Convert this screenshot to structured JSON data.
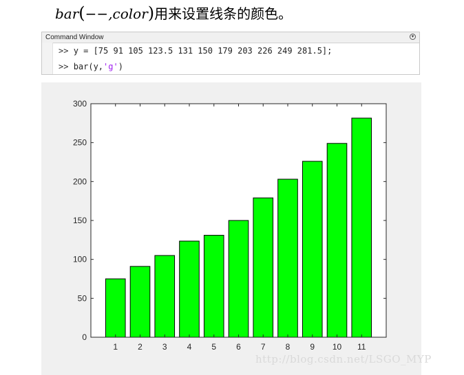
{
  "heading": {
    "formula": "bar",
    "paren_open": "(",
    "args": "−−,color",
    "paren_close": ")",
    "text": "用来设置线条的颜色。"
  },
  "command_window": {
    "title": "Command Window",
    "lines": [
      {
        "prompt": ">>",
        "code": "y = [75 91 105 123.5 131 150 179 203 226 249 281.5];"
      },
      {
        "prompt": ">>",
        "code_before": "bar(y,",
        "string": "'g'",
        "code_after": ")"
      }
    ]
  },
  "chart_data": {
    "type": "bar",
    "categories": [
      "1",
      "2",
      "3",
      "4",
      "5",
      "6",
      "7",
      "8",
      "9",
      "10",
      "11"
    ],
    "values": [
      75,
      91,
      105,
      123.5,
      131,
      150,
      179,
      203,
      226,
      249,
      281.5
    ],
    "bar_color": "#00ff00",
    "edge_color": "#000000",
    "ylim": [
      0,
      300
    ],
    "yticks": [
      0,
      50,
      100,
      150,
      200,
      250,
      300
    ],
    "title": "",
    "xlabel": "",
    "ylabel": ""
  },
  "watermark": "http://blog.csdn.net/LSGO_MYP"
}
